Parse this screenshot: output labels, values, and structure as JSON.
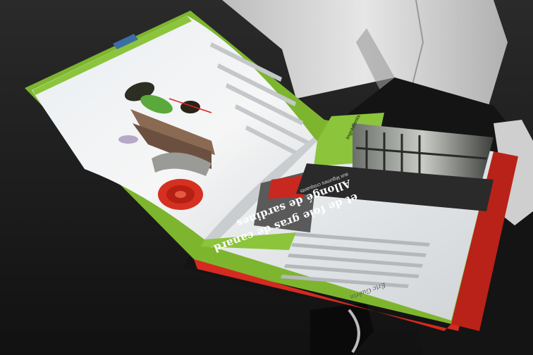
{
  "scene": {
    "description_tags": [
      "person",
      "open-book",
      "food-photo",
      "cookbook"
    ],
    "colors": {
      "background": "#1a1a1a",
      "shirt": "#d9d9d9",
      "book_green": "#8cc43c",
      "book_red": "#d42a20",
      "page": "#f2f2f2"
    }
  },
  "book": {
    "recipe_title_line1": "Allongé de sardines",
    "recipe_title_line2": "et de foie gras de canard",
    "recipe_subtitle": "aux légumes croquants",
    "author": "Éric Guérin",
    "sidebar_label": "Ingrédients"
  }
}
